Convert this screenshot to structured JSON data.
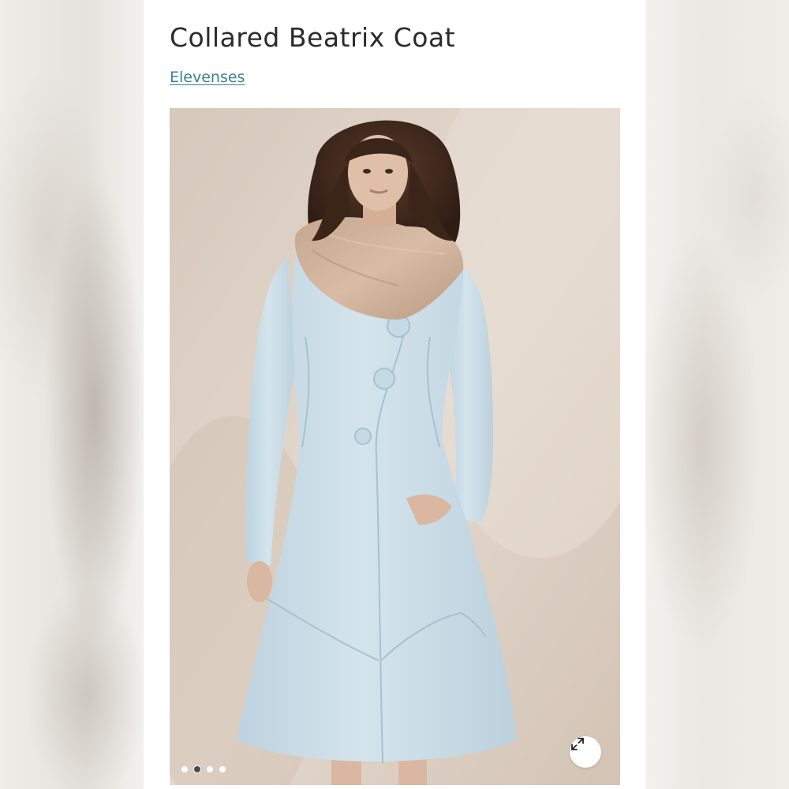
{
  "product": {
    "title": "Collared Beatrix Coat",
    "brand": "Elevenses"
  },
  "gallery": {
    "image_count": 4,
    "active_index": 1,
    "expand_icon": "expand-arrows-icon"
  },
  "colors": {
    "brand_link": "#3a7f95",
    "title_text": "#2b2b2b",
    "coat": "#cfe0ea",
    "collar": "#c9a98f",
    "backdrop": "#dccfc3"
  }
}
